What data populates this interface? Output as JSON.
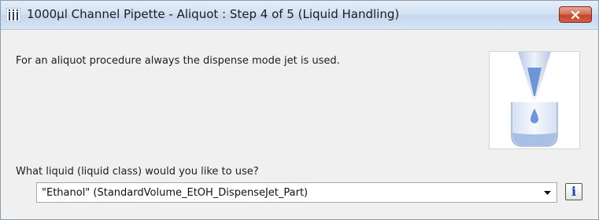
{
  "window": {
    "title": "1000µl Channel Pipette - Aliquot : Step 4 of 5 (Liquid Handling)"
  },
  "icons": {
    "app": "pipette-channels-icon",
    "close": "close-icon",
    "dropdown": "chevron-down-icon",
    "info": "info-icon",
    "illustration": "pipette-dispense-jet-illustration"
  },
  "colors": {
    "close_button": "#c4452a",
    "info_icon": "#1b3fae",
    "liquid": "#6f95d6"
  },
  "content": {
    "description": "For an aliquot procedure always the dispense mode jet is used.",
    "question": "What liquid (liquid class) would you like to use?",
    "liquid_class": {
      "selected": "\"Ethanol\"  (StandardVolume_EtOH_DispenseJet_Part)"
    },
    "info_button_label": "i"
  }
}
